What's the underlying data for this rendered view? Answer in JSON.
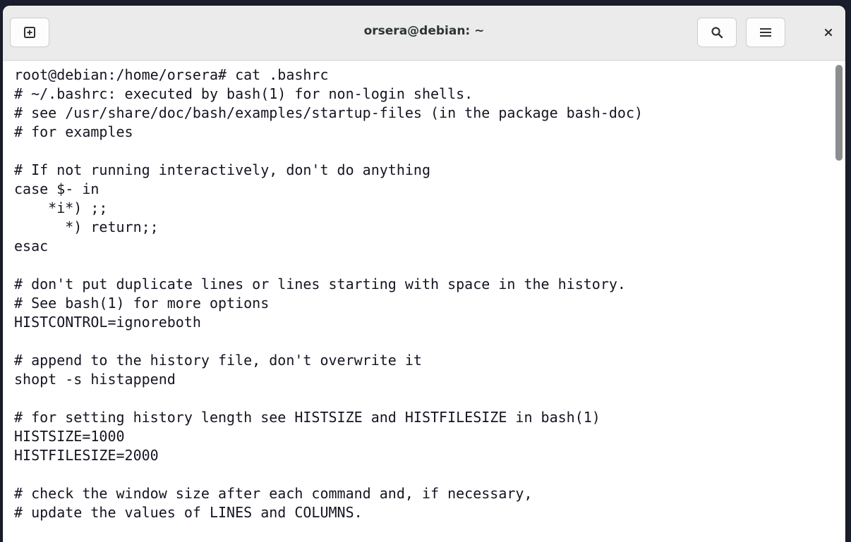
{
  "window": {
    "title": "orsera@debian: ~"
  },
  "headerbar": {
    "buttons": [
      "new-tab-icon",
      "search-icon",
      "menu-icon",
      "close-icon"
    ]
  },
  "terminal": {
    "lines": [
      "root@debian:/home/orsera# cat .bashrc",
      "# ~/.bashrc: executed by bash(1) for non-login shells.",
      "# see /usr/share/doc/bash/examples/startup-files (in the package bash-doc)",
      "# for examples",
      "",
      "# If not running interactively, don't do anything",
      "case $- in",
      "    *i*) ;;",
      "      *) return;;",
      "esac",
      "",
      "# don't put duplicate lines or lines starting with space in the history.",
      "# See bash(1) for more options",
      "HISTCONTROL=ignoreboth",
      "",
      "# append to the history file, don't overwrite it",
      "shopt -s histappend",
      "",
      "# for setting history length see HISTSIZE and HISTFILESIZE in bash(1)",
      "HISTSIZE=1000",
      "HISTFILESIZE=2000",
      "",
      "# check the window size after each command and, if necessary,",
      "# update the values of LINES and COLUMNS."
    ]
  },
  "colors": {
    "text": "#171421",
    "background": "#ffffff",
    "headerbar": "#ebebeb"
  }
}
